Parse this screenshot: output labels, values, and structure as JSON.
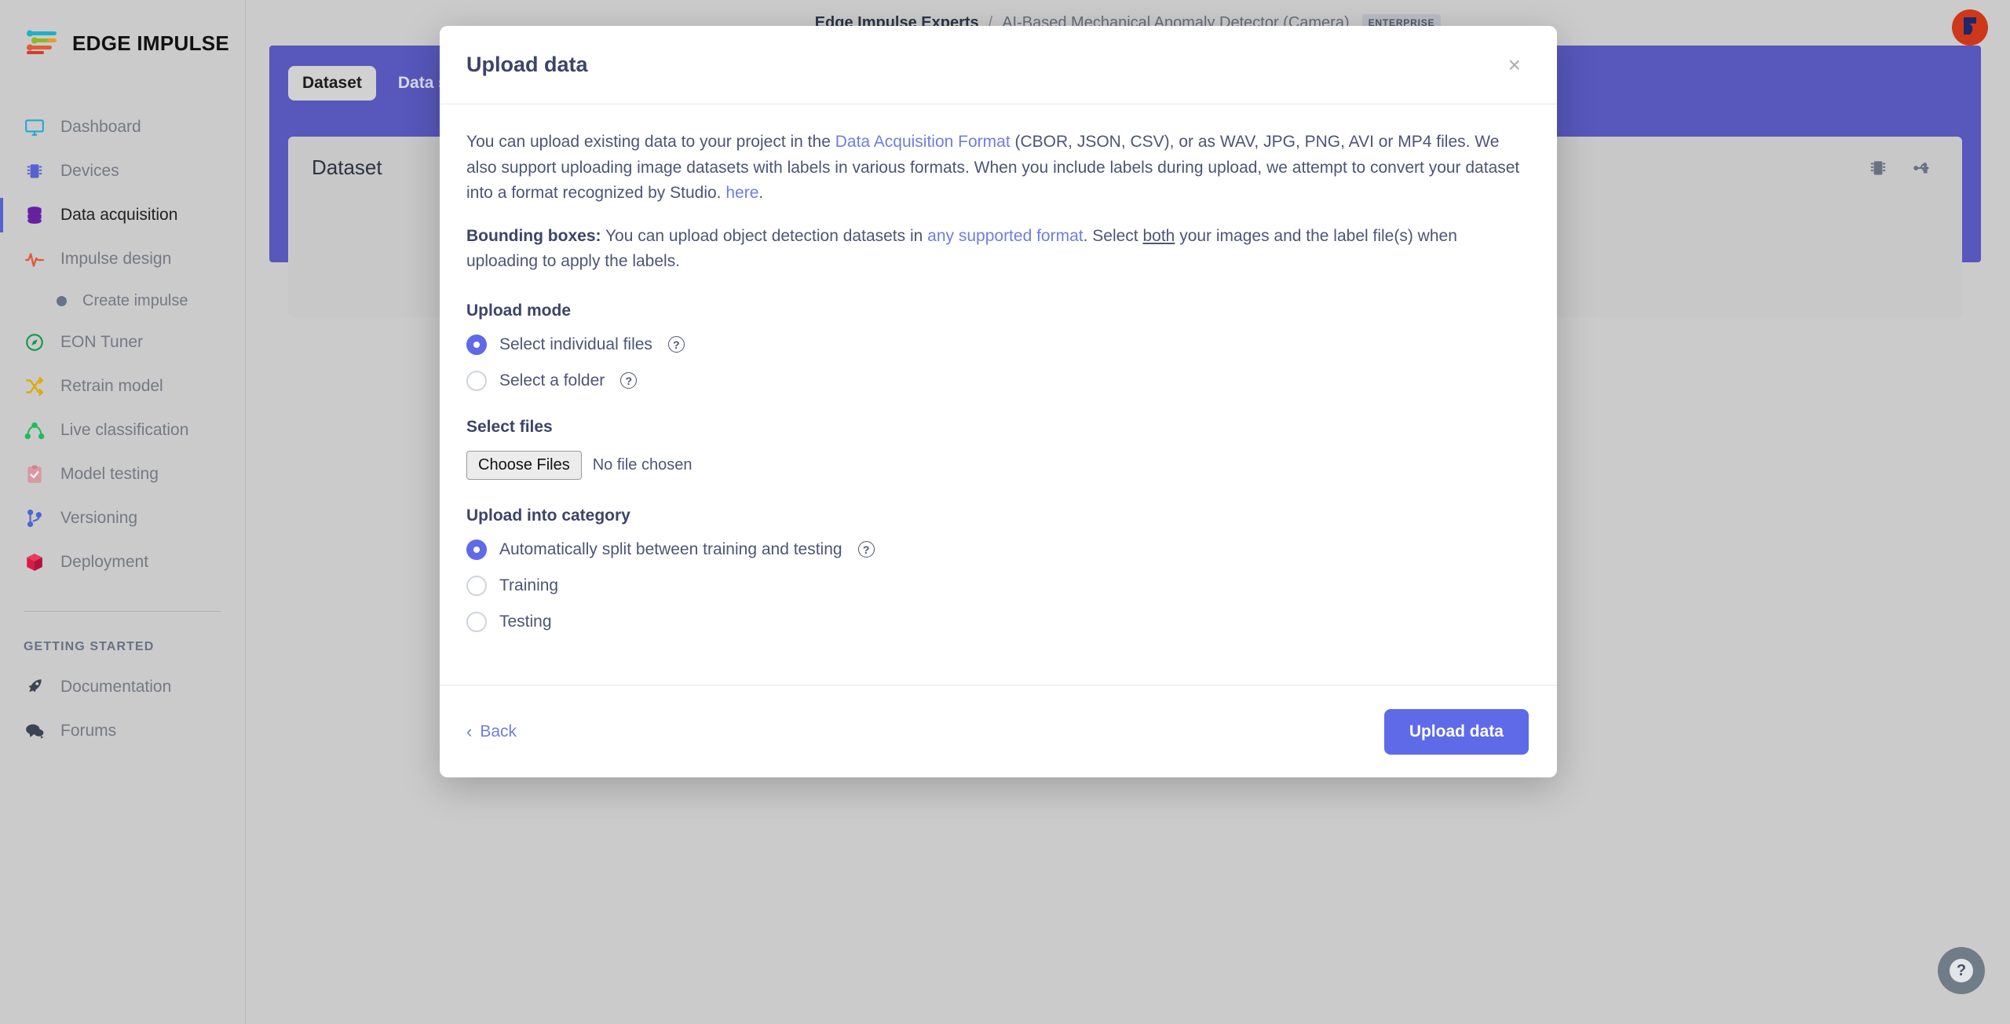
{
  "brand": {
    "name": "EDGE IMPULSE",
    "logo_icon": "edge-impulse-logo-icon"
  },
  "sidebar": {
    "items": [
      {
        "label": "Dashboard",
        "icon": "monitor-icon",
        "color": "#23b4d8",
        "active": false
      },
      {
        "label": "Devices",
        "icon": "chip-icon",
        "color": "#5a67d8",
        "active": false
      },
      {
        "label": "Data acquisition",
        "icon": "database-icon",
        "color": "#6b21a8",
        "active": true
      },
      {
        "label": "Impulse design",
        "icon": "pulse-wave-icon",
        "color": "#e8603c",
        "active": false
      }
    ],
    "sub_item": {
      "label": "Create impulse",
      "icon": "bullet-dot-icon"
    },
    "items_after": [
      {
        "label": "EON Tuner",
        "icon": "compass-icon",
        "color": "#16a34a",
        "active": false
      },
      {
        "label": "Retrain model",
        "icon": "shuffle-icon",
        "color": "#eab308",
        "active": false
      },
      {
        "label": "Live classification",
        "icon": "nodes-icon",
        "color": "#22c55e",
        "active": false
      },
      {
        "label": "Model testing",
        "icon": "clipboard-check-icon",
        "color": "#e18b94",
        "active": false
      },
      {
        "label": "Versioning",
        "icon": "git-branch-icon",
        "color": "#4f6bd8",
        "active": false
      },
      {
        "label": "Deployment",
        "icon": "cube-icon",
        "color": "#e11d48",
        "active": false
      }
    ],
    "section_title": "GETTING STARTED",
    "getting_started": [
      {
        "label": "Documentation",
        "icon": "rocket-icon",
        "color": "#3f4756"
      },
      {
        "label": "Forums",
        "icon": "chat-icon",
        "color": "#3f4756"
      }
    ]
  },
  "header": {
    "org": "Edge Impulse Experts",
    "separator": "/",
    "project": "AI-Based Mechanical Anomaly Detector (Camera)",
    "badge": "ENTERPRISE",
    "avatar_icon": "user-avatar"
  },
  "tabs": [
    {
      "label": "Dataset",
      "active": true
    },
    {
      "label": "Data sources",
      "active": false
    }
  ],
  "dataset_panel": {
    "title": "Dataset",
    "icons": [
      {
        "name": "chip-icon"
      },
      {
        "name": "usb-icon"
      }
    ]
  },
  "modal": {
    "title": "Upload data",
    "close_icon": "close-icon",
    "intro": {
      "p1_a": "You can upload existing data to your project in the ",
      "p1_link1": "Data Acquisition Format",
      "p1_b": " (CBOR, JSON, CSV), or as WAV, JPG, PNG, AVI or MP4 files. We also support uploading image datasets with labels in various formats. When you include labels during upload, we attempt to convert your dataset into a format recognized by Studio. ",
      "p1_link2": "here",
      "p1_c": "."
    },
    "bounding": {
      "label": "Bounding boxes:",
      "a": " You can upload object detection datasets in ",
      "link": "any supported format",
      "b": ". Select ",
      "underlined": "both",
      "c": " your images and the label file(s) when uploading to apply the labels."
    },
    "upload_mode": {
      "title": "Upload mode",
      "options": [
        {
          "label": "Select individual files",
          "checked": true,
          "help": "?"
        },
        {
          "label": "Select a folder",
          "checked": false,
          "help": "?"
        }
      ]
    },
    "select_files": {
      "title": "Select files",
      "button_label": "Choose Files",
      "status": "No file chosen"
    },
    "category": {
      "title": "Upload into category",
      "options": [
        {
          "label": "Automatically split between training and testing",
          "checked": true,
          "help": "?"
        },
        {
          "label": "Training",
          "checked": false,
          "help": null
        },
        {
          "label": "Testing",
          "checked": false,
          "help": null
        }
      ]
    },
    "footer": {
      "back_label": "Back",
      "back_chevron": "‹",
      "submit_label": "Upload data"
    }
  },
  "help_fab": {
    "glyph": "?",
    "icon": "question-mark-icon"
  },
  "colors": {
    "accent": "#5f6ae8",
    "band": "#5b5bc4",
    "link": "#6f7ee0",
    "sidebar_bg": "#d5d5d5",
    "title": "#3c4468"
  }
}
